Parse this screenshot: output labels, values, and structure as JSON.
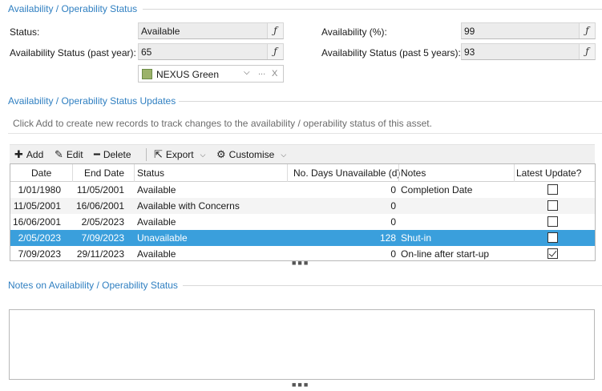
{
  "sections": {
    "status": "Availability / Operability Status",
    "updates": "Availability / Operability Status Updates",
    "notes": "Notes on Availability / Operability Status"
  },
  "fields": {
    "status": {
      "label": "Status:",
      "value": "Available"
    },
    "avail_past_year": {
      "label": "Availability Status (past year):",
      "value": "65"
    },
    "avail_pct": {
      "label": "Availability (%):",
      "value": "99"
    },
    "avail_past_5": {
      "label": "Availability Status (past 5 years):",
      "value": "93"
    },
    "fx_symbol": "ƒ"
  },
  "rating_dropdown": {
    "value": "NEXUS Green",
    "swatch_color": "#9bb26a",
    "ellipsis": "...",
    "clear": "X"
  },
  "hint": "Click Add to create new records to track changes to the availability / operability status of this asset.",
  "toolbar": {
    "add": "Add",
    "edit": "Edit",
    "delete": "Delete",
    "export": "Export",
    "customise": "Customise"
  },
  "table": {
    "columns": [
      "Date",
      "End Date",
      "Status",
      "No. Days Unavailable (d)",
      "Notes",
      "Latest Update?"
    ],
    "rows": [
      {
        "date": "1/01/1980",
        "end_date": "11/05/2001",
        "status": "Available",
        "days": "0",
        "notes": "Completion Date",
        "latest": false
      },
      {
        "date": "11/05/2001",
        "end_date": "16/06/2001",
        "status": "Available with Concerns",
        "days": "0",
        "notes": "",
        "latest": false
      },
      {
        "date": "16/06/2001",
        "end_date": "2/05/2023",
        "status": "Available",
        "days": "0",
        "notes": "",
        "latest": false
      },
      {
        "date": "2/05/2023",
        "end_date": "7/09/2023",
        "status": "Unavailable",
        "days": "128",
        "notes": "Shut-in",
        "latest": false
      },
      {
        "date": "7/09/2023",
        "end_date": "29/11/2023",
        "status": "Available",
        "days": "0",
        "notes": "On-line after start-up",
        "latest": true
      }
    ],
    "selected_row": 3
  },
  "colors": {
    "accent": "#2f7fc1",
    "selection": "#3a9fdc"
  }
}
